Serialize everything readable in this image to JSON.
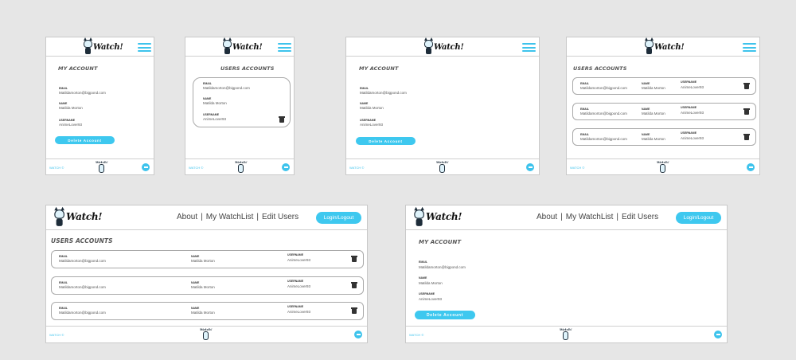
{
  "brand": {
    "name": "Watch!",
    "accent": "#3ec8ef"
  },
  "nav": {
    "about": "About",
    "watchlist": "My WatchList",
    "edit_users": "Edit Users",
    "login_logout": "Login/Logout",
    "separator": "|"
  },
  "my_account": {
    "title": "My Account",
    "email_label": "Email",
    "email": "Matildamorton@bigpond.com",
    "name_label": "Name",
    "name": "Matilda Morton",
    "username_label": "Username",
    "username": "AnimeLover93",
    "delete_button": "Delete Account"
  },
  "users_accounts": {
    "title": "Users Accounts",
    "email_label": "Email",
    "name_label": "Name",
    "username_label": "Username",
    "users": [
      {
        "email": "Matildamorton@bigpond.com",
        "name": "Matilda Morton",
        "username": "AnimeLover93"
      },
      {
        "email": "Matildamorton@bigpond.com",
        "name": "Matilda Morton",
        "username": "AnimeLover93"
      },
      {
        "email": "Matildamorton@bigpond.com",
        "name": "Matilda Morton",
        "username": "AnimeLover93"
      }
    ]
  },
  "footer": {
    "text": "WATCH ©",
    "logo_text": "Watch!"
  },
  "icons": {
    "menu": "hamburger-icon",
    "delete": "trash-icon",
    "footer_action": "circle-minus-icon",
    "logo": "mascot-logo"
  }
}
